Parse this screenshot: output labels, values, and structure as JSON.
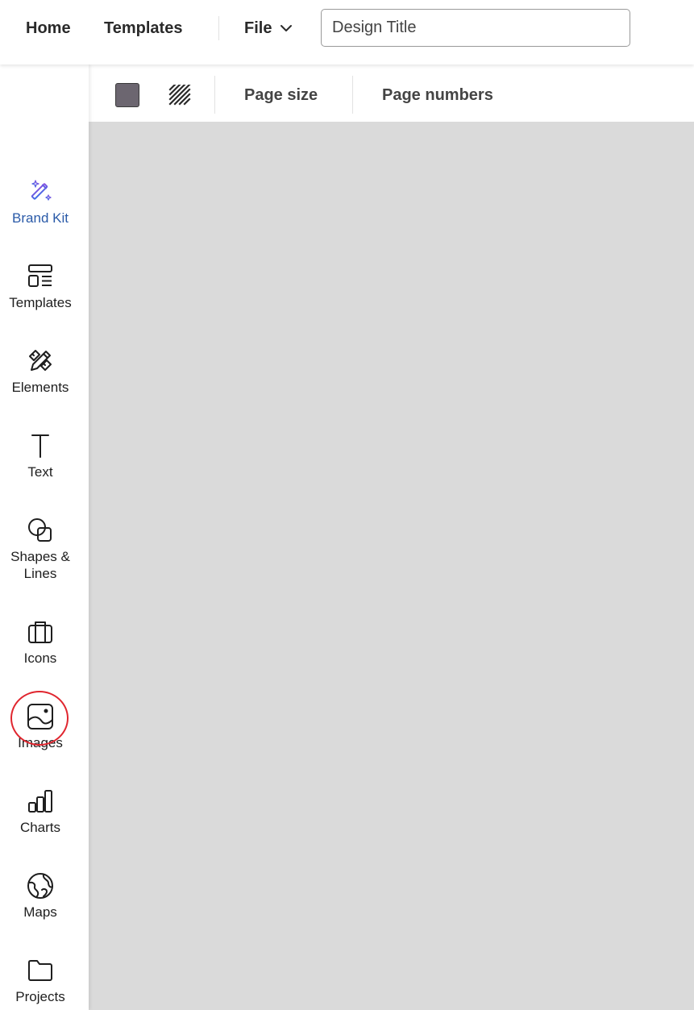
{
  "header": {
    "nav": [
      {
        "label": "Home"
      },
      {
        "label": "Templates"
      }
    ],
    "file_menu": {
      "label": "File",
      "icon": "chevron-down-icon"
    },
    "title_input": {
      "value": "Design Title"
    }
  },
  "toolbar": {
    "background_color": "#6c6670",
    "pattern_icon": "diagonal-stripes-icon",
    "page_size_label": "Page size",
    "page_numbers_label": "Page numbers"
  },
  "sidebar": {
    "items": [
      {
        "label": "Brand Kit",
        "icon": "magic-wand-icon",
        "active": true
      },
      {
        "label": "Templates",
        "icon": "templates-icon"
      },
      {
        "label": "Elements",
        "icon": "pencil-ruler-icon"
      },
      {
        "label": "Text",
        "icon": "text-icon"
      },
      {
        "label": "Shapes & Lines",
        "icon": "shapes-icon"
      },
      {
        "label": "Icons",
        "icon": "briefcase-icon"
      },
      {
        "label": "Images",
        "icon": "image-icon",
        "highlighted": true
      },
      {
        "label": "Charts",
        "icon": "bar-chart-icon"
      },
      {
        "label": "Maps",
        "icon": "globe-icon"
      },
      {
        "label": "Projects",
        "icon": "folder-icon"
      }
    ],
    "active_color": "#2a5aa8",
    "highlight_color": "#e0262f"
  },
  "canvas": {
    "background": "#dadada"
  }
}
